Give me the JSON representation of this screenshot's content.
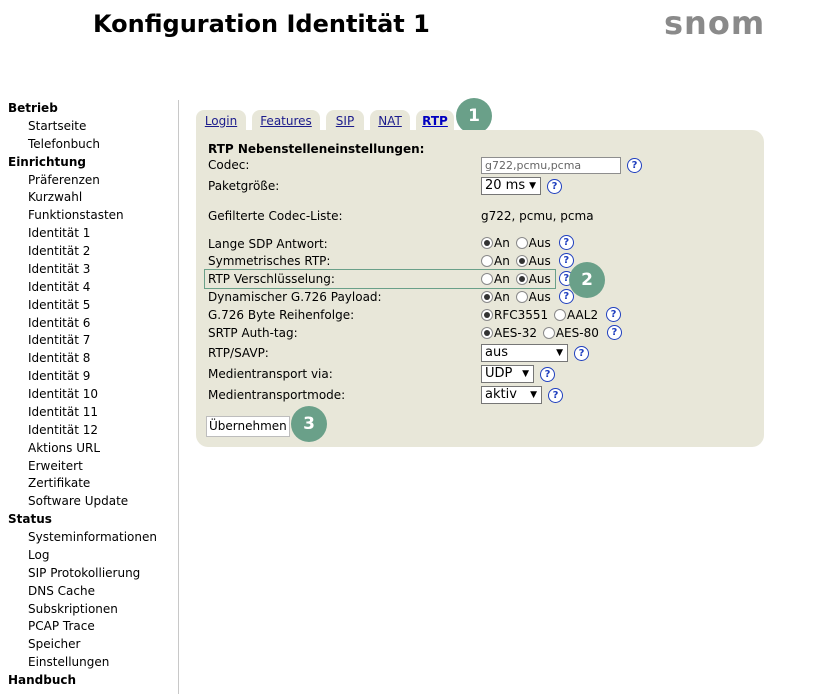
{
  "page": {
    "title": "Konfiguration Identität 1",
    "logo": "snom"
  },
  "sidebar": [
    {
      "type": "head",
      "label": "Betrieb"
    },
    {
      "type": "item",
      "label": "Startseite"
    },
    {
      "type": "item",
      "label": "Telefonbuch"
    },
    {
      "type": "head",
      "label": "Einrichtung"
    },
    {
      "type": "item",
      "label": "Präferenzen"
    },
    {
      "type": "item",
      "label": "Kurzwahl"
    },
    {
      "type": "item",
      "label": "Funktionstasten"
    },
    {
      "type": "item",
      "label": "Identität 1"
    },
    {
      "type": "item",
      "label": "Identität 2"
    },
    {
      "type": "item",
      "label": "Identität 3"
    },
    {
      "type": "item",
      "label": "Identität 4"
    },
    {
      "type": "item",
      "label": "Identität 5"
    },
    {
      "type": "item",
      "label": "Identität 6"
    },
    {
      "type": "item",
      "label": "Identität 7"
    },
    {
      "type": "item",
      "label": "Identität 8"
    },
    {
      "type": "item",
      "label": "Identität 9"
    },
    {
      "type": "item",
      "label": "Identität 10"
    },
    {
      "type": "item",
      "label": "Identität 11"
    },
    {
      "type": "item",
      "label": "Identität 12"
    },
    {
      "type": "item",
      "label": "Aktions URL"
    },
    {
      "type": "item",
      "label": "Erweitert"
    },
    {
      "type": "item",
      "label": "Zertifikate"
    },
    {
      "type": "item",
      "label": "Software Update"
    },
    {
      "type": "head",
      "label": "Status"
    },
    {
      "type": "item",
      "label": "Systeminformationen"
    },
    {
      "type": "item",
      "label": "Log"
    },
    {
      "type": "item",
      "label": "SIP Protokollierung"
    },
    {
      "type": "item",
      "label": "DNS Cache"
    },
    {
      "type": "item",
      "label": "Subskriptionen"
    },
    {
      "type": "item",
      "label": "PCAP Trace"
    },
    {
      "type": "item",
      "label": "Speicher"
    },
    {
      "type": "item",
      "label": "Einstellungen"
    },
    {
      "type": "head",
      "label": "Handbuch"
    }
  ],
  "tabs": [
    {
      "label": "Login",
      "active": false
    },
    {
      "label": "Features",
      "active": false
    },
    {
      "label": "SIP",
      "active": false
    },
    {
      "label": "NAT",
      "active": false
    },
    {
      "label": "RTP",
      "active": true
    }
  ],
  "form": {
    "section_title": "RTP Nebenstelleneinstellungen:",
    "codec_label": "Codec:",
    "codec_value": "g722,pcmu,pcma",
    "packet_label": "Paketgröße:",
    "packet_value": "20 ms",
    "filtered_label": "Gefilterte Codec-Liste:",
    "filtered_value": "g722, pcmu, pcma",
    "sdp_label": "Lange SDP Antwort:",
    "sym_label": "Symmetrisches RTP:",
    "enc_label": "RTP Verschlüsselung:",
    "g726_label": "Dynamischer G.726 Payload:",
    "byte_label": "G.726 Byte Reihenfolge:",
    "srtp_label": "SRTP Auth-tag:",
    "savp_label": "RTP/SAVP:",
    "savp_value": "aus",
    "transport_label": "Medientransport via:",
    "transport_value": "UDP",
    "mode_label": "Medientransportmode:",
    "mode_value": "aktiv",
    "on": "An",
    "off": "Aus",
    "rfc": "RFC3551",
    "aal2": "AAL2",
    "aes32": "AES-32",
    "aes80": "AES-80",
    "submit": "Übernehmen",
    "help": "?"
  },
  "radio_state": {
    "sdp": "An",
    "sym": "Aus",
    "enc": "Aus",
    "g726": "An",
    "byte": "RFC3551",
    "srtp": "AES-32"
  },
  "badges": [
    "1",
    "2",
    "3"
  ],
  "colors": {
    "panel": "#e8e7d9",
    "badge": "#6aa089",
    "link": "#1c1c8c"
  }
}
